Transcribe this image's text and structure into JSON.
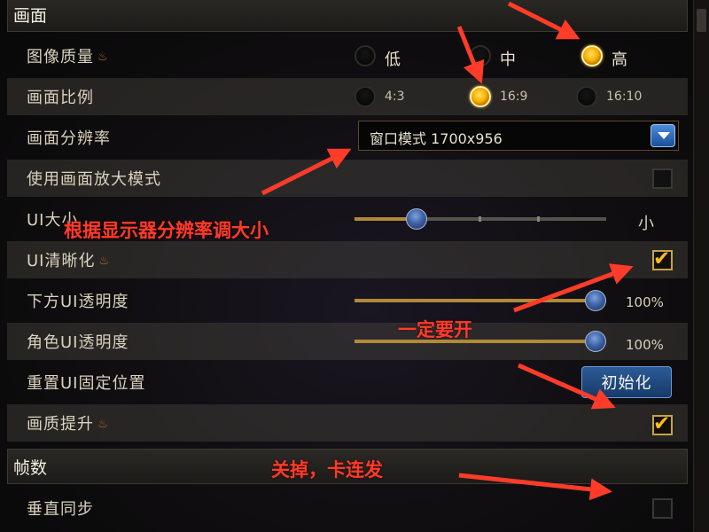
{
  "sections": {
    "display_title": "画面",
    "fps_title": "帧数"
  },
  "rows": {
    "image_quality": {
      "label": "图像质量",
      "options": [
        "低",
        "中",
        "高"
      ],
      "selected": "高"
    },
    "aspect_ratio": {
      "label": "画面比例",
      "options": [
        "4:3",
        "16:9",
        "16:10"
      ],
      "selected": "16:9"
    },
    "resolution": {
      "label": "画面分辨率",
      "value": "窗口模式 1700x956"
    },
    "zoom_mode": {
      "label": "使用画面放大模式",
      "checked": false
    },
    "ui_size": {
      "label": "UI大小",
      "value_text": "小",
      "level": 0.24
    },
    "ui_clarity": {
      "label": "UI清晰化",
      "checked": true
    },
    "bottom_ui_opacity": {
      "label": "下方UI透明度",
      "value_text": "100%",
      "level": 1.0
    },
    "char_ui_opacity": {
      "label": "角色UI透明度",
      "value_text": "100%",
      "level": 1.0
    },
    "reset_ui": {
      "label": "重置UI固定位置",
      "button": "初始化"
    },
    "quality_boost": {
      "label": "画质提升",
      "checked": true
    },
    "vsync": {
      "label": "垂直同步",
      "checked": false
    }
  },
  "annotations": {
    "resolution_note": "根据显示器分辨率调大小",
    "must_enable": "一定要开",
    "turn_off": "关掉，卡连发"
  },
  "colors": {
    "accent": "#ffb000",
    "annotation": "#ff3b2a",
    "button": "#2c5a96"
  },
  "icons": {
    "flame": "flame-icon",
    "check": "check-icon",
    "dropdown": "chevron-down-icon"
  }
}
